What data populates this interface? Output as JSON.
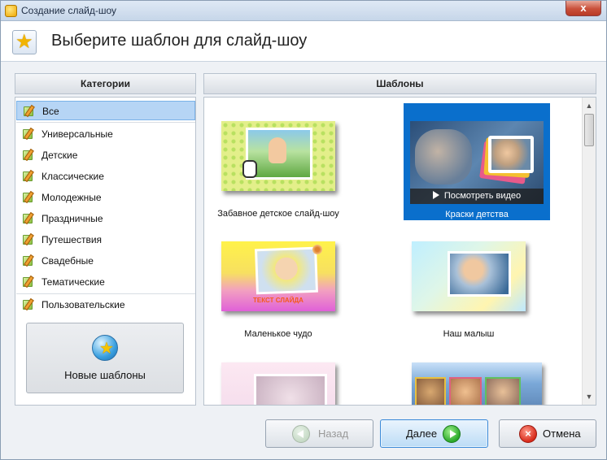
{
  "window": {
    "title": "Создание слайд-шоу",
    "close_glyph": "x"
  },
  "header": {
    "heading": "Выберите шаблон для слайд-шоу"
  },
  "categories": {
    "title": "Категории",
    "selected": "Все",
    "items": [
      {
        "label": "Все"
      },
      {
        "label": "Универсальные"
      },
      {
        "label": "Детские"
      },
      {
        "label": "Классические"
      },
      {
        "label": "Молодежные"
      },
      {
        "label": "Праздничные"
      },
      {
        "label": "Путешествия"
      },
      {
        "label": "Свадебные"
      },
      {
        "label": "Тематические"
      },
      {
        "label": "Пользовательские"
      }
    ],
    "new_templates_label": "Новые шаблоны"
  },
  "templates": {
    "title": "Шаблоны",
    "selected": "Краски детства",
    "items": [
      {
        "caption": "Забавное детское слайд-шоу"
      },
      {
        "caption": "Краски детства",
        "preview_label": "Посмотреть видео"
      },
      {
        "caption": "Маленькое чудо",
        "overlay_text": "ТЕКСТ СЛАЙДА"
      },
      {
        "caption": "Наш малыш"
      },
      {
        "caption": ""
      },
      {
        "caption": ""
      }
    ]
  },
  "buttons": {
    "back": "Назад",
    "next": "Далее",
    "cancel": "Отмена"
  },
  "colors": {
    "selection": "#0a6fcc",
    "accent_next": "#2aa82a",
    "accent_cancel": "#d82a1a"
  }
}
